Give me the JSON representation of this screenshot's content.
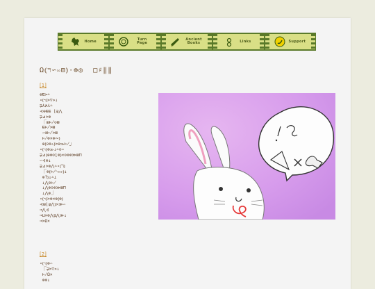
{
  "nav": [
    {
      "label": "Home",
      "icon": "dog-icon"
    },
    {
      "label": "Turn Page",
      "icon": "coin-icon"
    },
    {
      "label": "Ancient Books",
      "icon": "scroll-icon"
    },
    {
      "label": "Links",
      "icon": "links-icon"
    },
    {
      "label": "Support",
      "icon": "banana-icon"
    }
  ],
  "title": {
    "main": "Ω⦅ℸ∽∾⊟⦆·⊕◎",
    "sub": "□♯‖‖"
  },
  "sections": [
    {
      "link": "[1]",
      "lines": [
        "⊗⊑>∸",
        "∘⦅ℸ⦆>▽»↓",
        "⊋⅄≯⅄∸",
        "⊰⊕⊑⊑ ⌊⊋⋀",
        "⊋⊿>⊗",
        " ⎾⊞⊬⊝⊠",
        " ⊑⊬>⊠",
        " ∽⊕⊬>⊠",
        " ⊬⊗⨯⊗∾⦆",
        " ⊕⦅⊝⊗⊹⦆>⊕≫⊬⏌",
        "∘⦅ℸ⦆⊗≫↓∸⊙∘",
        "⊋⊿⦅⊕⊗⊙⌊⊗⦆⨯⊙⊗⊗≫⊠⊓",
        "∽⊰⊗↓",
        "⊋⊿>⊗⋀∸∘⦅ℸ⦆",
        " ⎾⊗⦅⊬∿∾⊹⦆↓",
        " ⊗?⦆↓∸⊥",
        " ↓⋀⊙⊬",
        " ↓⋀⊗⊙⊗≫⊠⊓",
        " ↓⋀⊗⏌",
        "∘⦅ℸ⦆>⊗⨯⊗⦅⊗⦆",
        "⊰⊞⌊⊋⋀⦆>≫∽",
        "⊸⋀⊰",
        "⊸⊔⨯⊗⋀⊋⋀≫↓",
        "⊸>Ω⨯"
      ]
    },
    {
      "link": "[2]",
      "lines": [
        "∘⦅ℸ⦆⊗∽",
        " ⎾⊋>▽»↓",
        " ⊬Ω⨯",
        " ⊗⊗↓"
      ]
    }
  ]
}
